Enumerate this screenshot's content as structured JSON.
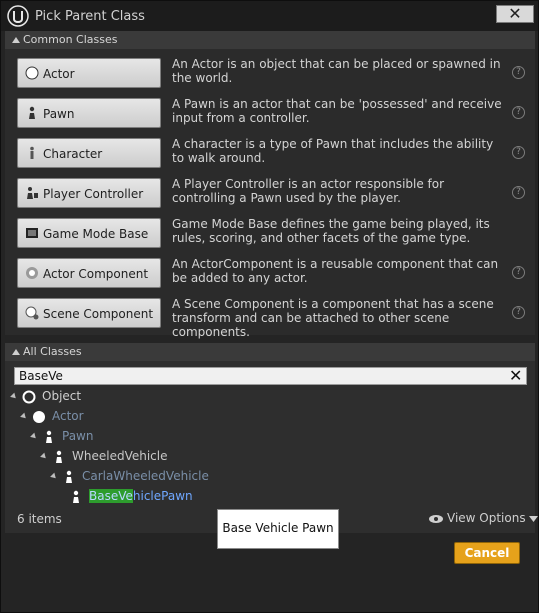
{
  "window": {
    "title": "Pick Parent Class",
    "close_label": "✕"
  },
  "common": {
    "header": "Common Classes",
    "items": [
      {
        "label": "Actor",
        "icon": "actor-sphere-icon",
        "desc": "An Actor is an object that can be placed or spawned in the world."
      },
      {
        "label": "Pawn",
        "icon": "pawn-icon",
        "desc": "A Pawn is an actor that can be 'possessed' and receive input from a controller."
      },
      {
        "label": "Character",
        "icon": "character-icon",
        "desc": "A character is a type of Pawn that includes the ability to walk around."
      },
      {
        "label": "Player Controller",
        "icon": "player-controller-icon",
        "desc": "A Player Controller is an actor responsible for controlling a Pawn used by the player."
      },
      {
        "label": "Game Mode Base",
        "icon": "game-mode-icon",
        "desc": "Game Mode Base defines the game being played, its rules, scoring, and other facets of the game type."
      },
      {
        "label": "Actor Component",
        "icon": "actor-component-icon",
        "desc": "An ActorComponent is a reusable component that can be added to any actor."
      },
      {
        "label": "Scene Component",
        "icon": "scene-component-icon",
        "desc": "A Scene Component is a component that has a scene transform and can be attached to other scene components."
      }
    ],
    "help_glyph": "?"
  },
  "all": {
    "header": "All Classes",
    "search_value": "BaseVe",
    "clear_glyph": "✕",
    "tree": [
      {
        "label": "Object",
        "depth": 0,
        "icon": "object-icon",
        "color": "#d0d0d0"
      },
      {
        "label": "Actor",
        "depth": 1,
        "icon": "actor-sphere-icon",
        "color": "#7a8fa8"
      },
      {
        "label": "Pawn",
        "depth": 2,
        "icon": "pawn-icon",
        "color": "#7a8fa8"
      },
      {
        "label": "WheeledVehicle",
        "depth": 3,
        "icon": "pawn-icon",
        "color": "#c8c8c8"
      },
      {
        "label": "CarlaWheeledVehicle",
        "depth": 4,
        "icon": "pawn-icon",
        "color": "#7a8fa8"
      },
      {
        "match": "BaseVe",
        "rest": "hiclePawn",
        "depth": 5,
        "icon": "pawn-icon",
        "color": "#6fa7ff"
      }
    ],
    "count": "6 items",
    "view_options": "View Options"
  },
  "tooltip": "Base Vehicle Pawn",
  "cancel_label": "Cancel"
}
